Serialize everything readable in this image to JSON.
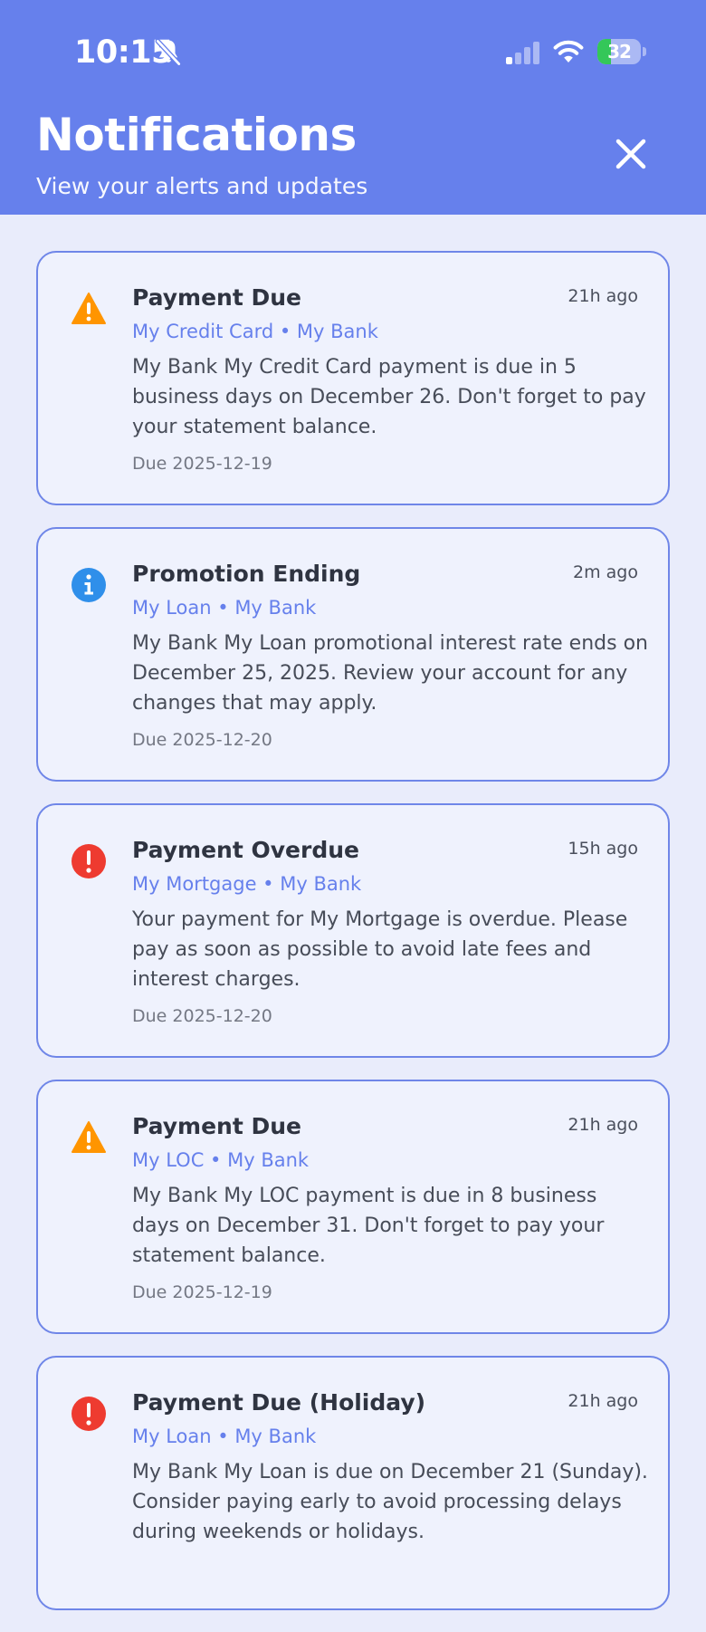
{
  "status_bar": {
    "time": "10:15",
    "battery": "32",
    "battery_level": 0.32
  },
  "header": {
    "title": "Notifications",
    "subtitle": "View your alerts and updates",
    "close_icon": "close-icon"
  },
  "colors": {
    "header_bg": "#6680EC",
    "page_bg": "#E9ECFB",
    "card_border": "#6F86E8",
    "accent": "#6680EC",
    "warning": "#FF9500",
    "info": "#2F8FEA",
    "error": "#EE3B30"
  },
  "notifications": [
    {
      "icon": "warning-icon",
      "title": "Payment Due",
      "time": "21h ago",
      "meta": "My Credit Card • My Bank",
      "message": "My Bank My Credit Card payment is due in 5 business days on December 26. Don't forget to pay your statement balance.",
      "due": "Due 2025-12-19"
    },
    {
      "icon": "info-icon",
      "title": "Promotion Ending",
      "time": "2m ago",
      "meta": "My Loan • My Bank",
      "message": "My Bank My Loan promotional interest rate ends on December 25, 2025. Review your account for any changes that may apply.",
      "due": "Due 2025-12-20"
    },
    {
      "icon": "error-icon",
      "title": "Payment Overdue",
      "time": "15h ago",
      "meta": "My Mortgage • My Bank",
      "message": "Your payment for My Mortgage is overdue. Please pay as soon as possible to avoid late fees and interest charges.",
      "due": "Due 2025-12-20"
    },
    {
      "icon": "warning-icon",
      "title": "Payment Due",
      "time": "21h ago",
      "meta": "My LOC • My Bank",
      "message": "My Bank My LOC payment is due in 8 business days on December 31. Don't forget to pay your statement balance.",
      "due": "Due 2025-12-19"
    },
    {
      "icon": "error-icon",
      "title": "Payment Due (Holiday)",
      "time": "21h ago",
      "meta": "My Loan • My Bank",
      "message": "My Bank My Loan is due on December 21 (Sunday). Consider paying early to avoid processing delays during weekends or holidays.",
      "due": ""
    }
  ]
}
